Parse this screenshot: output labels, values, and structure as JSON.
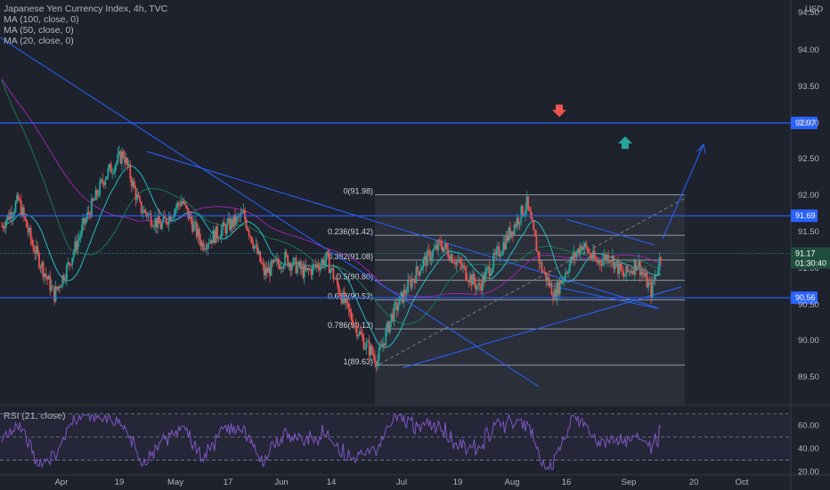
{
  "legend": {
    "title": "Japanese Yen Currency Index, 4h, TVC",
    "ma100": "MA (100, close, 0)",
    "ma50": "MA (50, close, 0)",
    "ma20": "MA (20, close, 0)"
  },
  "rsi_label": "RSI (21, close)",
  "currency": "USD",
  "colors": {
    "background": "#1e222d",
    "up": "#26a69a",
    "down": "#ef5350",
    "hline": "#2962ff",
    "ma20": "#26c6c6",
    "ma50": "#1f7a52",
    "ma100": "#9c27b0",
    "rsi": "#7e57c2",
    "fib_box": "#363a45",
    "price_tag": "#2962ff",
    "current_tag": "#1f4e3d"
  },
  "current_price": {
    "value": "91.17",
    "countdown": "01:30:40"
  },
  "chart_data": {
    "type": "candlestick",
    "ylim": [
      89.25,
      95.1
    ],
    "y_ticks": [
      "94.50",
      "94.00",
      "93.50",
      "93.00",
      "92.50",
      "92.00",
      "91.50",
      "91.00",
      "90.50",
      "90.00",
      "89.50"
    ],
    "x_ticks": [
      "Apr",
      "19",
      "May",
      "17",
      "Jun",
      "14",
      "Jul",
      "19",
      "Aug",
      "16",
      "Sep",
      "20",
      "Oct"
    ],
    "horizontal_levels": [
      {
        "label": "92.97",
        "value": 92.97
      },
      {
        "label": "91.69",
        "value": 91.69
      },
      {
        "label": "90.56",
        "value": 90.56
      }
    ],
    "fibonacci": [
      {
        "label": "0(91.98)",
        "value": 91.98
      },
      {
        "label": "0.236(91.42)",
        "value": 91.42
      },
      {
        "label": "0.382(91.08)",
        "value": 91.08
      },
      {
        "label": "0.5(90.80)",
        "value": 90.8
      },
      {
        "label": "0.618(90.53)",
        "value": 90.53
      },
      {
        "label": "0.786(90.13)",
        "value": 90.13
      },
      {
        "label": "1(89.63)",
        "value": 89.63
      }
    ],
    "markers": [
      {
        "type": "down-arrow",
        "value": 93.1
      },
      {
        "type": "up-arrow",
        "value": 92.7
      }
    ],
    "rsi": {
      "ylim": [
        18,
        72
      ],
      "y_ticks": [
        "60.00",
        "40.00",
        "20.00"
      ],
      "bands": [
        70,
        50,
        30
      ]
    }
  }
}
